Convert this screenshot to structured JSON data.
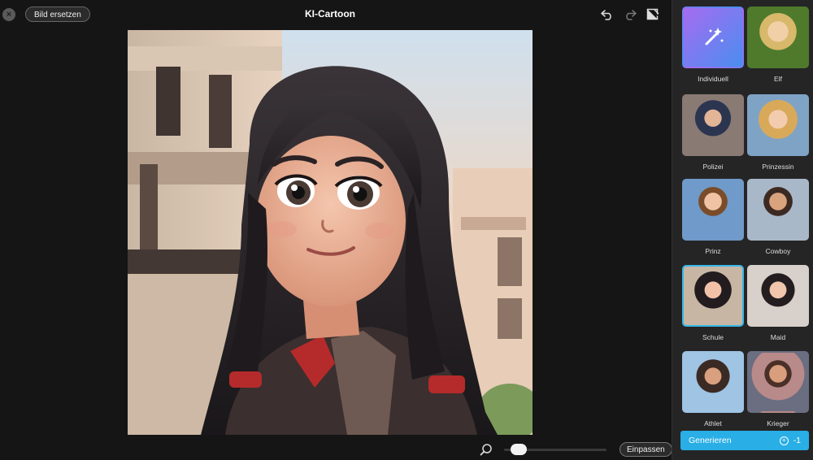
{
  "topbar": {
    "close_label": "×",
    "replace_label": "Bild ersetzen",
    "title": "KI-Cartoon"
  },
  "bottombar": {
    "fit_label": "Einpassen",
    "zoom_level": 0.08
  },
  "styles": [
    {
      "label": "Individuell",
      "icon": "magic-wand-icon",
      "selected": false
    },
    {
      "label": "Elf",
      "selected": false
    },
    {
      "label": "Polizei",
      "selected": false
    },
    {
      "label": "Prinzessin",
      "selected": false
    },
    {
      "label": "Prinz",
      "selected": false
    },
    {
      "label": "Cowboy",
      "selected": false
    },
    {
      "label": "Schule",
      "selected": true
    },
    {
      "label": "Maid",
      "selected": false
    },
    {
      "label": "Athlet",
      "selected": false
    },
    {
      "label": "Krieger",
      "selected": false
    }
  ],
  "generate": {
    "label": "Generieren",
    "cost": "-1"
  },
  "colors": {
    "accent": "#29aee6",
    "selected_border": "#38b8e8",
    "panel_bg": "#252525",
    "app_bg": "#151515"
  }
}
